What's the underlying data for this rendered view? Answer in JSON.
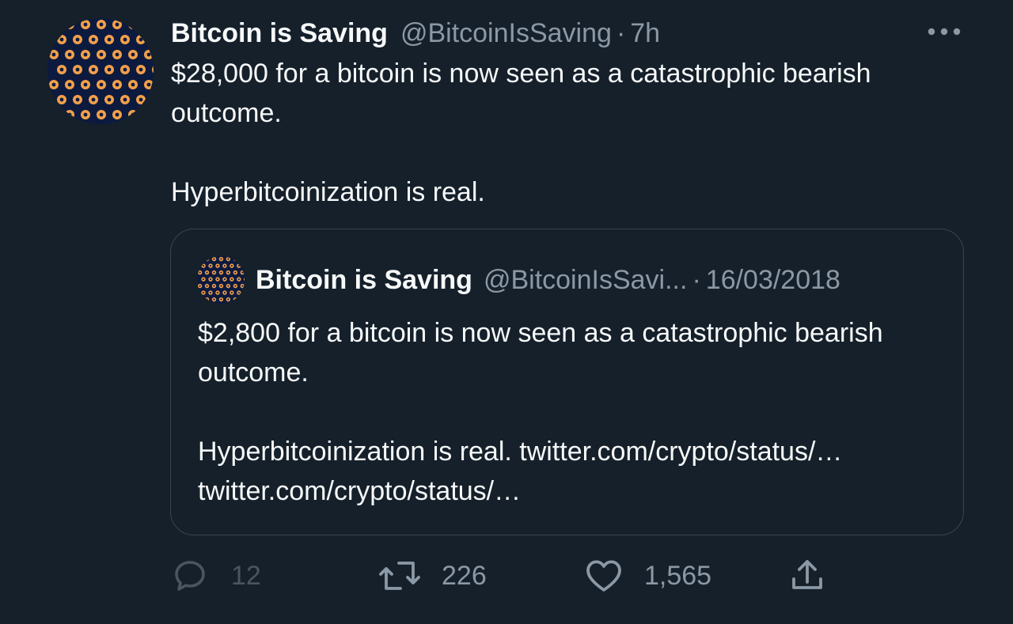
{
  "tweet": {
    "author_name": "Bitcoin is Saving",
    "author_handle": "@BitcoinIsSaving",
    "separator": "·",
    "time": "7h",
    "text_line1": "$28,000 for a bitcoin is now seen as a catastrophic bearish outcome.",
    "text_line2": "Hyperbitcoinization is real."
  },
  "quoted_tweet": {
    "author_name": "Bitcoin is Saving",
    "author_handle": "@BitcoinIsSavi...",
    "separator": "·",
    "date": "16/03/2018",
    "text_line1": "$2,800 for a bitcoin is now seen as a catastrophic bearish outcome.",
    "text_line2": "Hyperbitcoinization is real. twitter.com/crypto/status/… twitter.com/crypto/status/…"
  },
  "actions": {
    "reply_count": "12",
    "retweet_count": "226",
    "like_count": "1,565"
  },
  "icons": {
    "more": "more-horizontal-icon",
    "reply": "reply-icon",
    "retweet": "retweet-icon",
    "like": "heart-icon",
    "share": "share-icon"
  },
  "colors": {
    "background": "#15202b",
    "text_primary": "#f7f9f9",
    "text_secondary": "#8b98a5",
    "border": "#38444d",
    "avatar_background": "#0d1a3f",
    "avatar_coin": "#f2a04a"
  }
}
